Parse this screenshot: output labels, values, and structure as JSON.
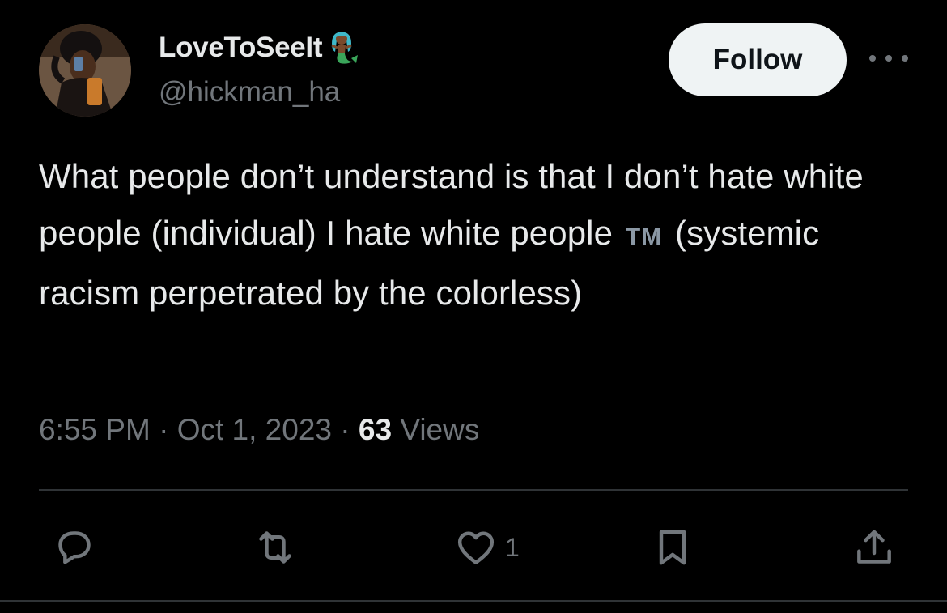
{
  "author": {
    "display_name": "LoveToSeeIt",
    "name_emoji": "mermaid-emoji-icon",
    "handle": "@hickman_ha",
    "avatar": "profile-photo"
  },
  "header": {
    "follow_label": "Follow",
    "more_icon": "more-horizontal-icon"
  },
  "tweet": {
    "text_before_tm": "What people don’t understand is that I don’t hate white people (individual) I hate white people",
    "tm_label": "TM",
    "text_after_tm": "(systemic racism perpetrated by the colorless)"
  },
  "meta": {
    "time": "6:55 PM",
    "separator": "·",
    "date": "Oct 1, 2023",
    "views_count": "63",
    "views_label": "Views"
  },
  "actions": {
    "reply_icon": "reply-icon",
    "retweet_icon": "retweet-icon",
    "like_icon": "heart-icon",
    "like_count": "1",
    "bookmark_icon": "bookmark-icon",
    "share_icon": "share-icon"
  },
  "colors": {
    "background": "#000000",
    "primary_text": "#e7e9ea",
    "secondary_text": "#71767b",
    "divider": "#2f3336",
    "follow_bg": "#eff3f4",
    "follow_text": "#0f1419"
  }
}
